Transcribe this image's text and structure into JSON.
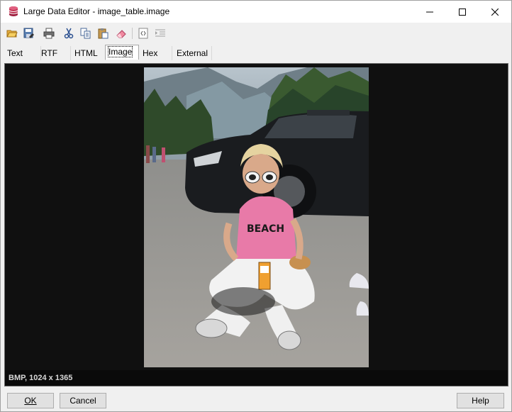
{
  "window": {
    "title": "Large Data Editor - image_table.image",
    "app_icon": "database-icon"
  },
  "toolbar": {
    "buttons": [
      {
        "name": "open-icon"
      },
      {
        "name": "save-as-icon"
      },
      {
        "name": "print-icon"
      },
      {
        "name": "cut-icon"
      },
      {
        "name": "copy-icon"
      },
      {
        "name": "paste-icon"
      },
      {
        "name": "eraser-icon"
      },
      {
        "name": "source-icon"
      },
      {
        "name": "indent-icon"
      }
    ]
  },
  "tabs": [
    {
      "label": "Text"
    },
    {
      "label": "RTF"
    },
    {
      "label": "HTML"
    },
    {
      "label": "Image",
      "active": true
    },
    {
      "label": "Hex"
    },
    {
      "label": "External"
    }
  ],
  "viewer": {
    "status": "BMP, 1024 x 1365",
    "background_color": "#101010"
  },
  "buttons": {
    "ok": "OK",
    "cancel": "Cancel",
    "help": "Help"
  }
}
